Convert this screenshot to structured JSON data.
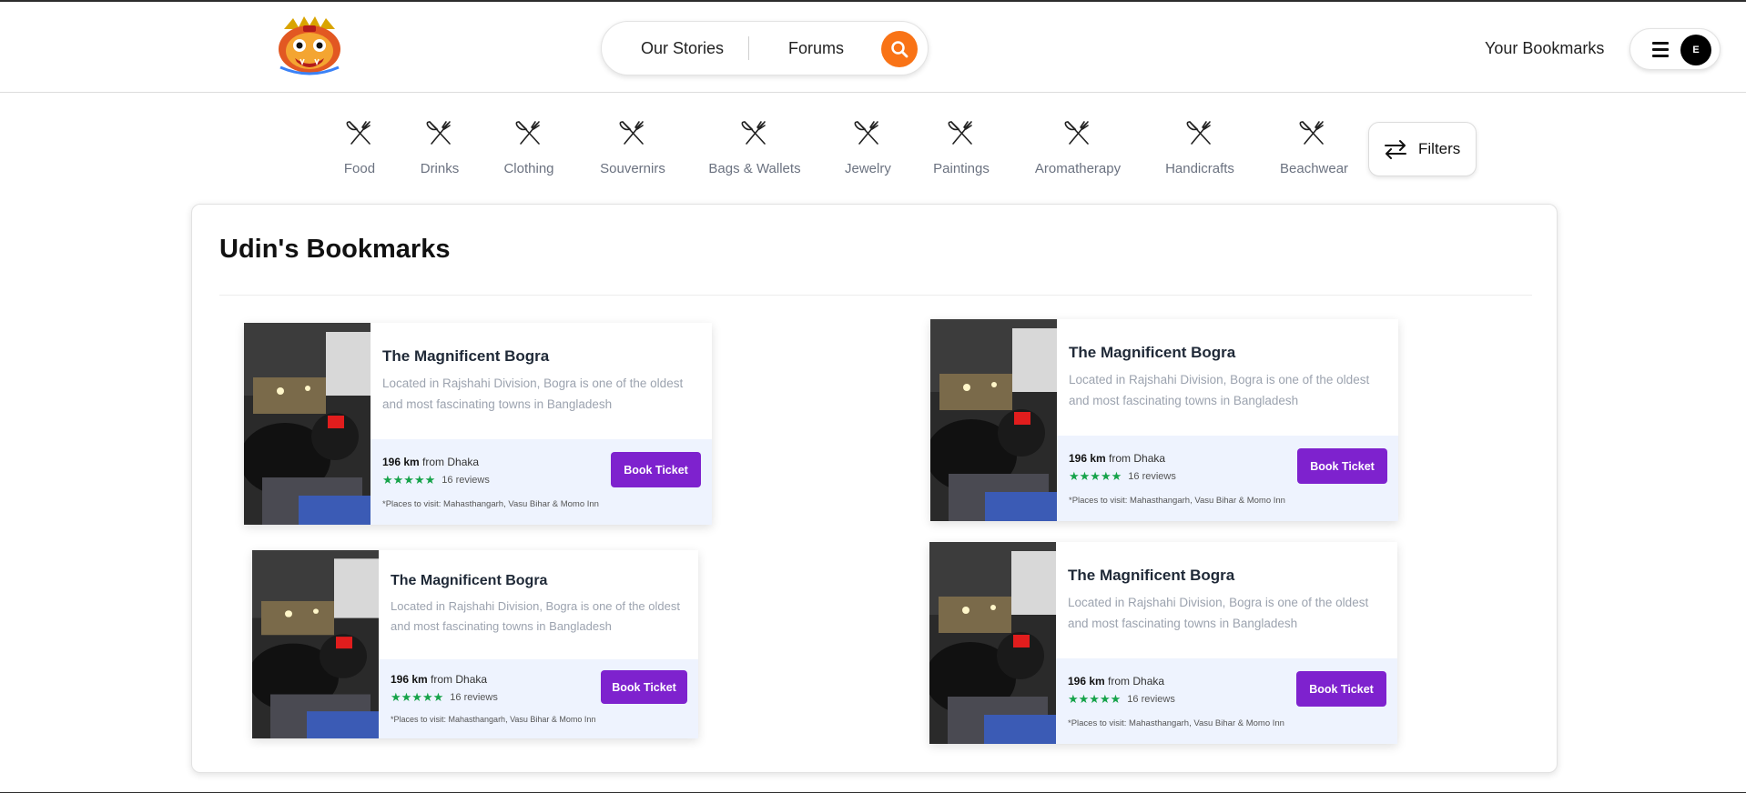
{
  "header": {
    "nav": {
      "stories": "Our Stories",
      "forums": "Forums"
    },
    "bookmarks_link": "Your Bookmarks",
    "avatar_initial": "E",
    "accent": "#f97316"
  },
  "categories": [
    {
      "label": "Food",
      "icon": "utensils-icon"
    },
    {
      "label": "Drinks",
      "icon": "utensils-icon"
    },
    {
      "label": "Clothing",
      "icon": "utensils-icon"
    },
    {
      "label": "Souvernirs",
      "icon": "utensils-icon"
    },
    {
      "label": "Bags & Wallets",
      "icon": "utensils-icon"
    },
    {
      "label": "Jewelry",
      "icon": "utensils-icon"
    },
    {
      "label": "Paintings",
      "icon": "utensils-icon"
    },
    {
      "label": "Aromatherapy",
      "icon": "utensils-icon"
    },
    {
      "label": "Handicrafts",
      "icon": "utensils-icon"
    },
    {
      "label": "Beachwear",
      "icon": "utensils-icon"
    }
  ],
  "filters_label": "Filters",
  "main": {
    "title": "Udin's Bookmarks",
    "cards": [
      {
        "title": "The Magnificent Bogra",
        "description": "Located in Rajshahi Division, Bogra is one of the oldest and most fascinating towns in Bangladesh",
        "distance_value": "196 km",
        "distance_suffix": "from Dhaka",
        "stars": "★★★★★",
        "reviews": "16 reviews",
        "places": "*Places to visit: Mahasthangarh, Vasu Bihar & Momo Inn",
        "button": "Book Ticket"
      },
      {
        "title": "The Magnificent Bogra",
        "description": "Located in Rajshahi Division, Bogra is one of the oldest and most fascinating towns in Bangladesh",
        "distance_value": "196 km",
        "distance_suffix": "from Dhaka",
        "stars": "★★★★★",
        "reviews": "16 reviews",
        "places": "*Places to visit: Mahasthangarh, Vasu Bihar & Momo Inn",
        "button": "Book Ticket"
      },
      {
        "title": "The Magnificent Bogra",
        "description": "Located in Rajshahi Division, Bogra is one of the oldest and most fascinating towns in Bangladesh",
        "distance_value": "196 km",
        "distance_suffix": "from Dhaka",
        "stars": "★★★★★",
        "reviews": "16 reviews",
        "places": "*Places to visit: Mahasthangarh, Vasu Bihar & Momo Inn",
        "button": "Book Ticket"
      },
      {
        "title": "The Magnificent Bogra",
        "description": "Located in Rajshahi Division, Bogra is one of the oldest and most fascinating towns in Bangladesh",
        "distance_value": "196 km",
        "distance_suffix": "from Dhaka",
        "stars": "★★★★★",
        "reviews": "16 reviews",
        "places": "*Places to visit: Mahasthangarh, Vasu Bihar & Momo Inn",
        "button": "Book Ticket"
      }
    ]
  },
  "colors": {
    "button": "#7e22ce",
    "stars": "#16a34a",
    "card_footer": "#eef3fe",
    "search": "#f97316"
  }
}
